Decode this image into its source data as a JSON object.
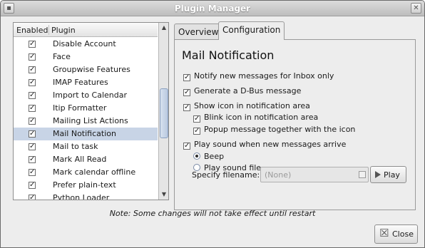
{
  "window": {
    "title": "Plugin Manager"
  },
  "plugin_list": {
    "columns": [
      "Enabled",
      "Plugin"
    ],
    "rows": [
      {
        "enabled": true,
        "name": "Disable Account"
      },
      {
        "enabled": true,
        "name": "Face"
      },
      {
        "enabled": true,
        "name": "Groupwise Features"
      },
      {
        "enabled": true,
        "name": "IMAP Features"
      },
      {
        "enabled": true,
        "name": "Import to Calendar"
      },
      {
        "enabled": true,
        "name": "Itip Formatter"
      },
      {
        "enabled": true,
        "name": "Mailing List Actions"
      },
      {
        "enabled": true,
        "name": "Mail Notification",
        "selected": true
      },
      {
        "enabled": true,
        "name": "Mail to task"
      },
      {
        "enabled": true,
        "name": "Mark All Read"
      },
      {
        "enabled": true,
        "name": "Mark calendar offline"
      },
      {
        "enabled": true,
        "name": "Prefer plain-text"
      },
      {
        "enabled": true,
        "name": "Python Loader"
      }
    ],
    "check_glyph": "✓"
  },
  "tabs": [
    {
      "label": "Overview",
      "active": false
    },
    {
      "label": "Configuration",
      "active": true
    }
  ],
  "config": {
    "title": "Mail Notification",
    "options": {
      "notify_inbox_only": {
        "label": "Notify new messages for Inbox only",
        "checked": true
      },
      "dbus": {
        "label": "Generate a D-Bus message",
        "checked": true
      },
      "show_icon": {
        "label": "Show icon in notification area",
        "checked": true
      },
      "blink_icon": {
        "label": "Blink icon in notification area",
        "checked": true
      },
      "popup_message": {
        "label": "Popup message together with the icon",
        "checked": true
      },
      "play_sound": {
        "label": "Play sound when new messages arrive",
        "checked": true
      }
    },
    "sound": {
      "beep_label": "Beep",
      "beep_selected": true,
      "file_label": "Play sound file",
      "file_selected": false,
      "specify_label": "Specify filename:",
      "filename_value": "(None)",
      "play_label": "Play"
    }
  },
  "note": "Note: Some changes will not take effect until restart",
  "close_label": "Close",
  "colors": {
    "selection": "#c8d4e6",
    "window_bg": "#ededed"
  }
}
